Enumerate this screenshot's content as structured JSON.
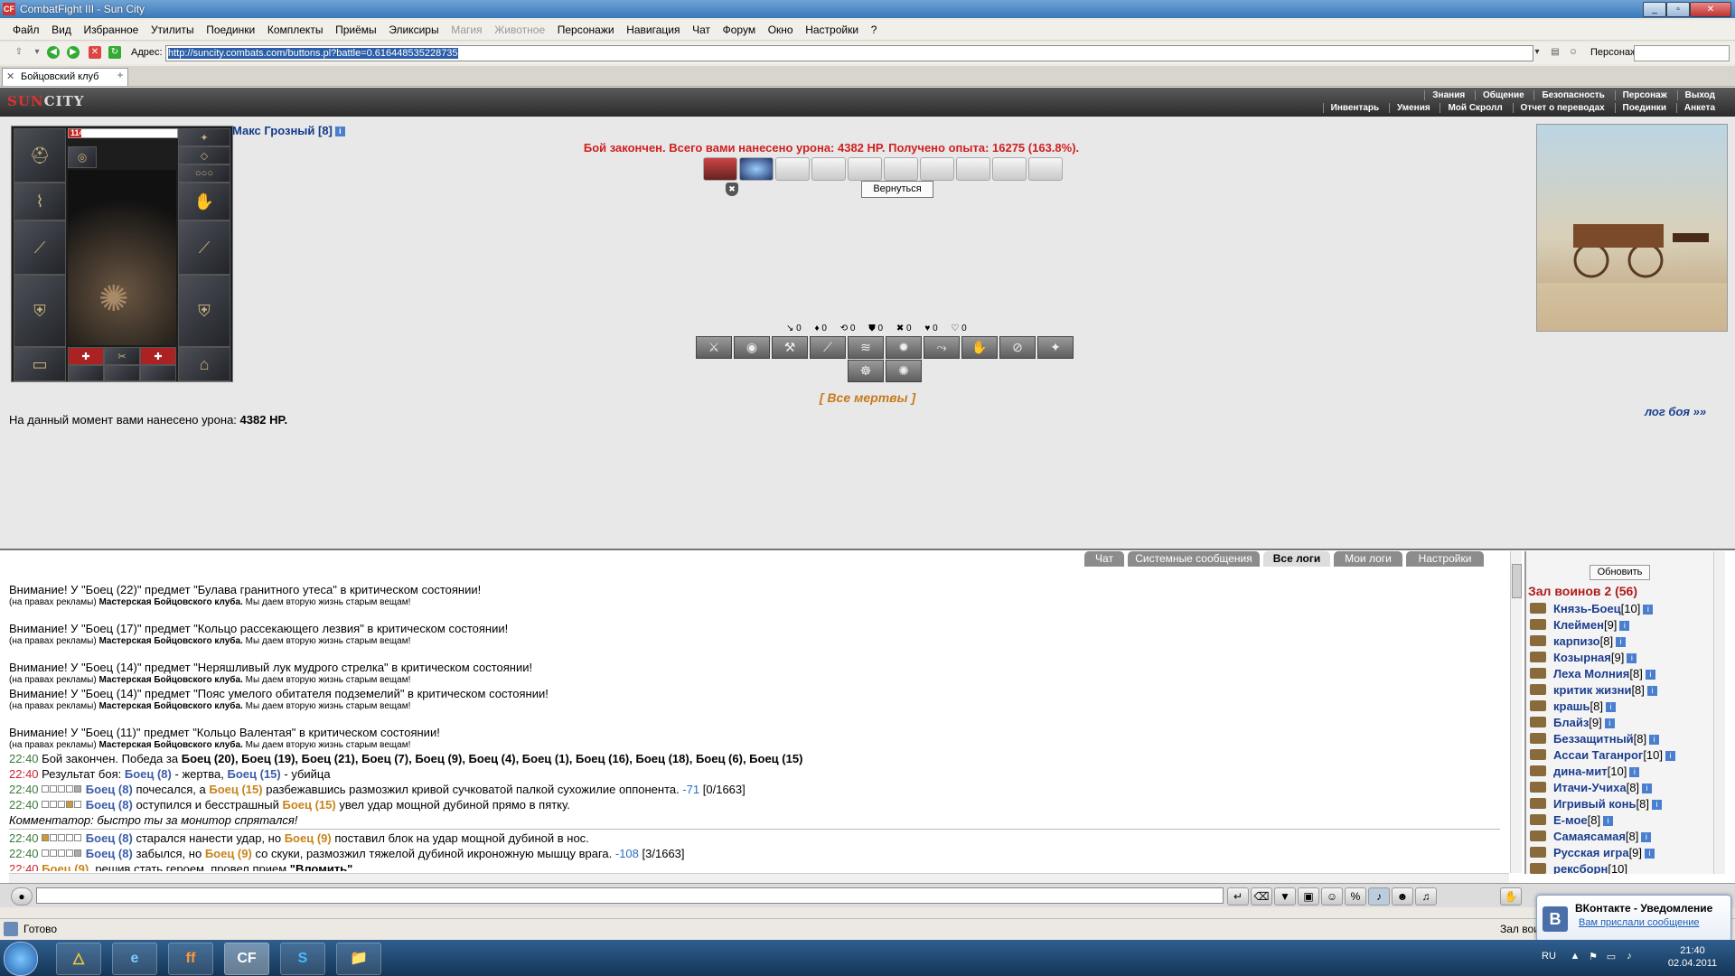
{
  "window": {
    "title": "CombatFight III - Sun City",
    "icon": "CF",
    "controls": [
      "_",
      "▫",
      "✕"
    ]
  },
  "menu": [
    "Файл",
    "Вид",
    "Избранное",
    "Утилиты",
    "Поединки",
    "Комплекты",
    "Приёмы",
    "Эликсиры",
    "Магия",
    "Животное",
    "Персонажи",
    "Навигация",
    "Чат",
    "Форум",
    "Окно",
    "Настройки",
    "?"
  ],
  "menu_disabled": [
    "Магия",
    "Животное"
  ],
  "address": {
    "label": "Адрес:",
    "url": "http://suncity.combats.com/buttons.pl?battle=0.616448535228735",
    "persona_label": "Персонаж:"
  },
  "tabs": [
    {
      "label": "Бойцовский клуб"
    }
  ],
  "game_nav": {
    "row1": [
      "Знания",
      "Общение",
      "Безопасность",
      "Персонаж",
      "Выход"
    ],
    "row2": [
      "Инвентарь",
      "Умения",
      "Мой Скролл",
      "Отчет о переводах",
      "Поединки",
      "Анкета"
    ],
    "logo": {
      "sun": "SUN",
      "city": "CITY"
    }
  },
  "character": {
    "name": "Макс Грозный [8]",
    "info": "i",
    "hp": "114/932",
    "hp_fraction": 0.12
  },
  "battle": {
    "result": "Бой закончен. Всего вами нанесено урона: 4382 HP. Получено опыта: 16275 (163.8%).",
    "return_button": "Вернуться",
    "counters": [
      "↘ 0",
      "♦ 0",
      "⟲ 0",
      "⛊ 0",
      "✖ 0",
      "♥ 0",
      "♡ 0"
    ],
    "all_dead": "[ Все мертвы ]",
    "damage_label": "На данный момент вами нанесено урона:",
    "damage_value": "4382 HP.",
    "log_link": "лог боя »»"
  },
  "chat_tabs": [
    "Чат",
    "Системные сообщения",
    "Все логи",
    "Мои логи",
    "Настройки"
  ],
  "chat_active_tab": "Все логи",
  "chat_log": {
    "warn1": "Внимание! У \"Боец (22)\" предмет \"Булава гранитного утеса\" в критическом состоянии!",
    "warn2": "Внимание! У \"Боец (17)\" предмет \"Кольцо рассекающего лезвия\" в критическом состоянии!",
    "warn3": "Внимание! У \"Боец (14)\" предмет \"Неряшливый лук мудрого стрелка\" в критическом состоянии!",
    "warn4": "Внимание! У \"Боец (14)\" предмет \"Пояс умелого обитателя подземелий\" в критическом состоянии!",
    "warn5": "Внимание! У \"Боец (11)\" предмет \"Кольцо Валентая\" в критическом состоянии!",
    "ad_prefix": "(на правах рекламы)",
    "ad_shop": "Мастерская Бойцовского клуба.",
    "ad_text": "Мы даем вторую жизнь старым вещам!",
    "time": "22:40",
    "end_text": "Бой закончен. Победа за",
    "end_winners": "Боец (20), Боец (19), Боец (21), Боец (7), Боец (9), Боец (4), Боец (1), Боец (16), Боец (18), Боец (6), Боец (15)",
    "result_label": "Результат боя:",
    "victim": "Боец (8)",
    "victim_role": "- жертва,",
    "killer": "Боец (15)",
    "killer_role": "- убийца",
    "l1_a": "почесался, а",
    "l1_b": "разбежавшись размозжил кривой сучковатой палкой сухожилие оппонента.",
    "l1_dmg": "-71",
    "l1_hp": "[0/1663]",
    "l2_a": "оступился и бесстрашный",
    "l2_b": "увел удар мощной дубиной прямо в пятку.",
    "commentator": "Комментатор: быстро ты за монитор спрятался!",
    "l3_a": "старался нанести удар, но",
    "l3_b": "поставил блок на удар мощной дубиной в нос.",
    "l4_a": "забылся, но",
    "l4_b": "со скуки, размозжил тяжелой дубиной икроножную мышцу врага.",
    "l4_dmg": "-108",
    "l4_hp": "[3/1663]",
    "fighter9": "Боец (9)",
    "l5": ", решив стать героем, провел прием",
    "l5_b": "\"Вломить\"."
  },
  "players_panel": {
    "refresh": "Обновить",
    "hall": "Зал воинов 2 (56)",
    "players": [
      {
        "name": "Князь-Боец",
        "level": "[10]"
      },
      {
        "name": "Клеймен",
        "level": "[9]"
      },
      {
        "name": "карпизо",
        "level": "[8]"
      },
      {
        "name": "Козырная",
        "level": "[9]"
      },
      {
        "name": "Леха Молния",
        "level": "[8]"
      },
      {
        "name": "критик жизни",
        "level": "[8]"
      },
      {
        "name": "крашь",
        "level": "[8]"
      },
      {
        "name": "Блайз",
        "level": "[9]"
      },
      {
        "name": "Беззащитный",
        "level": "[8]"
      },
      {
        "name": "Ассаи Таганрог",
        "level": "[10]"
      },
      {
        "name": "дина-мит",
        "level": "[10]"
      },
      {
        "name": "Итачи-Учиха",
        "level": "[8]"
      },
      {
        "name": "Игривый конь",
        "level": "[8]"
      },
      {
        "name": "Е-мое",
        "level": "[8]"
      },
      {
        "name": "Самаясамая",
        "level": "[8]"
      },
      {
        "name": "Русская игра",
        "level": "[9]"
      },
      {
        "name": "рексборн",
        "level": "[10]"
      }
    ]
  },
  "statusbar": {
    "text": "Готово",
    "zone": "Зал вои"
  },
  "notification": {
    "logo": "В",
    "title": "ВКонтакте - Уведомление",
    "text": "Вам прислали сообщение"
  },
  "taskbar": {
    "lang": "RU",
    "time": "21:40",
    "date": "02.04.2011",
    "apps": [
      "△",
      "e",
      "ff",
      "CF",
      "S",
      "📁"
    ]
  }
}
